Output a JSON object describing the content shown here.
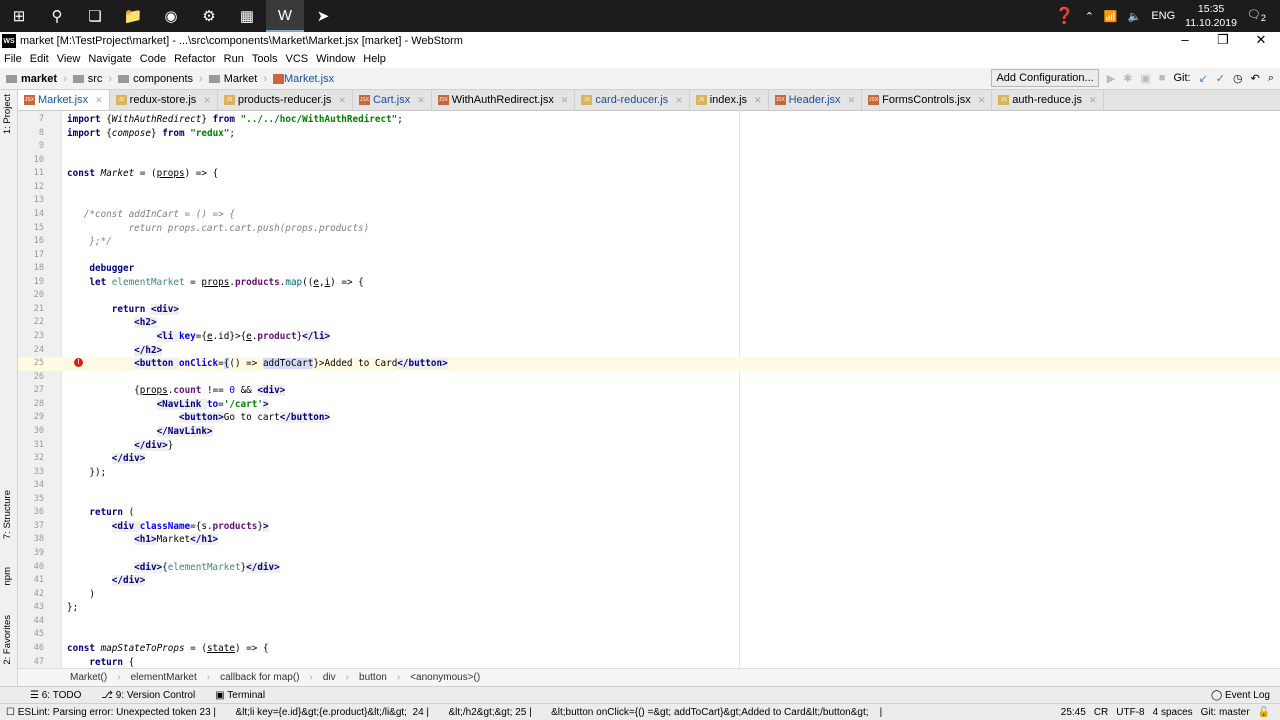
{
  "taskbar": {
    "icons": [
      "windows-start",
      "search",
      "task-view",
      "file-explorer",
      "chrome",
      "settings-app",
      "calculator",
      "webstorm",
      "telegram"
    ],
    "tray": {
      "lang": "ENG",
      "time": "15:35",
      "date": "11.10.2019",
      "notifications": "2"
    }
  },
  "window": {
    "title": "market [M:\\TestProject\\market] - ...\\src\\components\\Market\\Market.jsx [market] - WebStorm",
    "logo": "WS"
  },
  "menu": [
    "File",
    "Edit",
    "View",
    "Navigate",
    "Code",
    "Refactor",
    "Run",
    "Tools",
    "VCS",
    "Window",
    "Help"
  ],
  "nav": {
    "crumbs": [
      "market",
      "src",
      "components",
      "Market",
      "Market.jsx"
    ],
    "add_config": "Add Configuration...",
    "git_label": "Git:"
  },
  "tabs": [
    {
      "label": "Market.jsx",
      "type": "jsx",
      "active": true
    },
    {
      "label": "redux-store.js",
      "type": "js"
    },
    {
      "label": "products-reducer.js",
      "type": "js"
    },
    {
      "label": "Cart.jsx",
      "type": "jsx"
    },
    {
      "label": "WithAuthRedirect.jsx",
      "type": "jsx"
    },
    {
      "label": "card-reducer.js",
      "type": "js"
    },
    {
      "label": "index.js",
      "type": "js"
    },
    {
      "label": "Header.jsx",
      "type": "jsx"
    },
    {
      "label": "FormsControls.jsx",
      "type": "jsx"
    },
    {
      "label": "auth-reduce.js",
      "type": "js"
    }
  ],
  "side_tabs": [
    "1: Project",
    "7: Structure",
    "npm",
    "2: Favorites"
  ],
  "code": [
    {
      "n": "7",
      "t": [
        [
          "import ",
          "kw"
        ],
        [
          "{",
          ""
        ],
        [
          "WithAuthRedirect",
          "it"
        ],
        [
          "} ",
          ""
        ],
        [
          "from ",
          "kw"
        ],
        [
          "\"../../hoc/WithAuthRedirect\"",
          "str"
        ],
        [
          ";",
          ""
        ]
      ]
    },
    {
      "n": "8",
      "t": [
        [
          "import ",
          "kw"
        ],
        [
          "{",
          ""
        ],
        [
          "compose",
          "it"
        ],
        [
          "} ",
          ""
        ],
        [
          "from ",
          "kw"
        ],
        [
          "\"redux\"",
          "str"
        ],
        [
          ";",
          ""
        ]
      ]
    },
    {
      "n": "9",
      "t": []
    },
    {
      "n": "10",
      "t": []
    },
    {
      "n": "11",
      "t": [
        [
          "const ",
          "kw"
        ],
        [
          "Market",
          "it"
        ],
        [
          " = (",
          ""
        ],
        [
          "props",
          "ul"
        ],
        [
          ") => {",
          ""
        ]
      ]
    },
    {
      "n": "12",
      "t": []
    },
    {
      "n": "13",
      "t": []
    },
    {
      "n": "14",
      "t": [
        [
          "   /*const addInCart = () => {",
          "cmt"
        ]
      ]
    },
    {
      "n": "15",
      "t": [
        [
          "           return props.cart.cart.push(props.products)",
          "cmt"
        ]
      ]
    },
    {
      "n": "16",
      "t": [
        [
          "    };*/",
          "cmt"
        ]
      ]
    },
    {
      "n": "17",
      "t": []
    },
    {
      "n": "18",
      "t": [
        [
          "    ",
          ""
        ],
        [
          "debugger",
          "kw"
        ]
      ]
    },
    {
      "n": "19",
      "t": [
        [
          "    ",
          ""
        ],
        [
          "let ",
          "kw"
        ],
        [
          "elementMarket",
          "loc"
        ],
        [
          " = ",
          ""
        ],
        [
          "props",
          "ul"
        ],
        [
          ".",
          ""
        ],
        [
          "products",
          "fld"
        ],
        [
          ".",
          ""
        ],
        [
          "map",
          "fn"
        ],
        [
          "((",
          ""
        ],
        [
          "e",
          "ul"
        ],
        [
          ",",
          ""
        ],
        [
          "i",
          "ul"
        ],
        [
          ") => {",
          ""
        ]
      ]
    },
    {
      "n": "20",
      "t": []
    },
    {
      "n": "21",
      "t": [
        [
          "        ",
          ""
        ],
        [
          "return ",
          "kw"
        ],
        [
          "<div>",
          "tag"
        ]
      ]
    },
    {
      "n": "22",
      "t": [
        [
          "            ",
          ""
        ],
        [
          "<h2>",
          "tag"
        ]
      ]
    },
    {
      "n": "23",
      "t": [
        [
          "                ",
          ""
        ],
        [
          "<li ",
          "tag"
        ],
        [
          "key",
          "attr"
        ],
        [
          "={",
          ""
        ],
        [
          "e",
          "ul"
        ],
        [
          ".id}>{",
          ""
        ],
        [
          "e",
          "ul"
        ],
        [
          ".",
          ""
        ],
        [
          "product",
          "fld"
        ],
        [
          "}",
          ""
        ],
        [
          "</li>",
          "tag"
        ]
      ]
    },
    {
      "n": "24",
      "t": [
        [
          "            ",
          ""
        ],
        [
          "</h2>",
          "tag"
        ]
      ]
    },
    {
      "n": "25",
      "cur": true,
      "err": true,
      "t": [
        [
          "            ",
          ""
        ],
        [
          "<button ",
          "tag"
        ],
        [
          "onClick",
          "attr"
        ],
        [
          "=",
          ""
        ],
        [
          "{",
          "sel"
        ],
        [
          "() => ",
          ""
        ],
        [
          "addToCart",
          "sel"
        ],
        [
          "}>Added to Card",
          ""
        ],
        [
          "</button>",
          "tag"
        ]
      ]
    },
    {
      "n": "26",
      "t": []
    },
    {
      "n": "27",
      "t": [
        [
          "            {",
          ""
        ],
        [
          "props",
          "ul"
        ],
        [
          ".",
          ""
        ],
        [
          "count",
          "fld"
        ],
        [
          " !== ",
          ""
        ],
        [
          "0",
          "num"
        ],
        [
          " && ",
          ""
        ],
        [
          "<div>",
          "tag"
        ]
      ]
    },
    {
      "n": "28",
      "t": [
        [
          "                ",
          ""
        ],
        [
          "<NavLink ",
          "tag"
        ],
        [
          "to",
          "attr"
        ],
        [
          "=",
          ""
        ],
        [
          "'/cart'",
          "str"
        ],
        [
          ">",
          "tag"
        ]
      ]
    },
    {
      "n": "29",
      "t": [
        [
          "                    ",
          ""
        ],
        [
          "<button>",
          "tag"
        ],
        [
          "Go to cart",
          ""
        ],
        [
          "</button>",
          "tag"
        ]
      ]
    },
    {
      "n": "30",
      "t": [
        [
          "                ",
          ""
        ],
        [
          "</NavLink>",
          "tag"
        ]
      ]
    },
    {
      "n": "31",
      "t": [
        [
          "            ",
          ""
        ],
        [
          "</div>",
          "tag"
        ],
        [
          "}",
          ""
        ]
      ]
    },
    {
      "n": "32",
      "t": [
        [
          "        ",
          ""
        ],
        [
          "</div>",
          "tag"
        ]
      ]
    },
    {
      "n": "33",
      "t": [
        [
          "    });",
          ""
        ]
      ]
    },
    {
      "n": "34",
      "t": []
    },
    {
      "n": "35",
      "t": []
    },
    {
      "n": "36",
      "t": [
        [
          "    ",
          ""
        ],
        [
          "return ",
          "kw"
        ],
        [
          "(",
          ""
        ]
      ]
    },
    {
      "n": "37",
      "t": [
        [
          "        ",
          ""
        ],
        [
          "<div ",
          "tag"
        ],
        [
          "className",
          "attr"
        ],
        [
          "={s.",
          ""
        ],
        [
          "products",
          "fld"
        ],
        [
          "}",
          ""
        ],
        [
          ">",
          "tag"
        ]
      ]
    },
    {
      "n": "38",
      "t": [
        [
          "            ",
          ""
        ],
        [
          "<h1>",
          "tag"
        ],
        [
          "Market",
          ""
        ],
        [
          "</h1>",
          "tag"
        ]
      ]
    },
    {
      "n": "39",
      "t": []
    },
    {
      "n": "40",
      "t": [
        [
          "            ",
          ""
        ],
        [
          "<div>",
          "tag"
        ],
        [
          "{",
          ""
        ],
        [
          "elementMarket",
          "loc"
        ],
        [
          "}",
          ""
        ],
        [
          "</div>",
          "tag"
        ]
      ]
    },
    {
      "n": "41",
      "t": [
        [
          "        ",
          ""
        ],
        [
          "</div>",
          "tag"
        ]
      ]
    },
    {
      "n": "42",
      "t": [
        [
          "    )",
          ""
        ]
      ]
    },
    {
      "n": "43",
      "t": [
        [
          "};",
          ""
        ]
      ]
    },
    {
      "n": "44",
      "t": []
    },
    {
      "n": "45",
      "t": []
    },
    {
      "n": "46",
      "t": [
        [
          "const ",
          "kw"
        ],
        [
          "mapStateToProps",
          "it"
        ],
        [
          " = (",
          ""
        ],
        [
          "state",
          "ul"
        ],
        [
          ") => {",
          ""
        ]
      ]
    },
    {
      "n": "47",
      "t": [
        [
          "    ",
          ""
        ],
        [
          "return ",
          "kw"
        ],
        [
          "{",
          ""
        ]
      ]
    }
  ],
  "code_breadcrumb": [
    "Market()",
    "elementMarket",
    "callback for map()",
    "div",
    "button",
    "<anonymous>()"
  ],
  "tool_windows": [
    "6: TODO",
    "9: Version Control",
    "Terminal"
  ],
  "event_log": "Event Log",
  "status": {
    "message": "ESLint: Parsing error: Unexpected token 23 |       &lt;li key={e.id}&gt;{e.product}&lt;/li&gt;  24 |       &lt;/h2&gt;&gt; 25 |       &lt;button onClick={() =&gt; addToCart}&gt;Added to Card&lt;/button&gt;    |",
    "position": "25:45",
    "line_sep": "CR",
    "encoding": "UTF-8",
    "indent": "4 spaces",
    "git": "Git: master"
  }
}
